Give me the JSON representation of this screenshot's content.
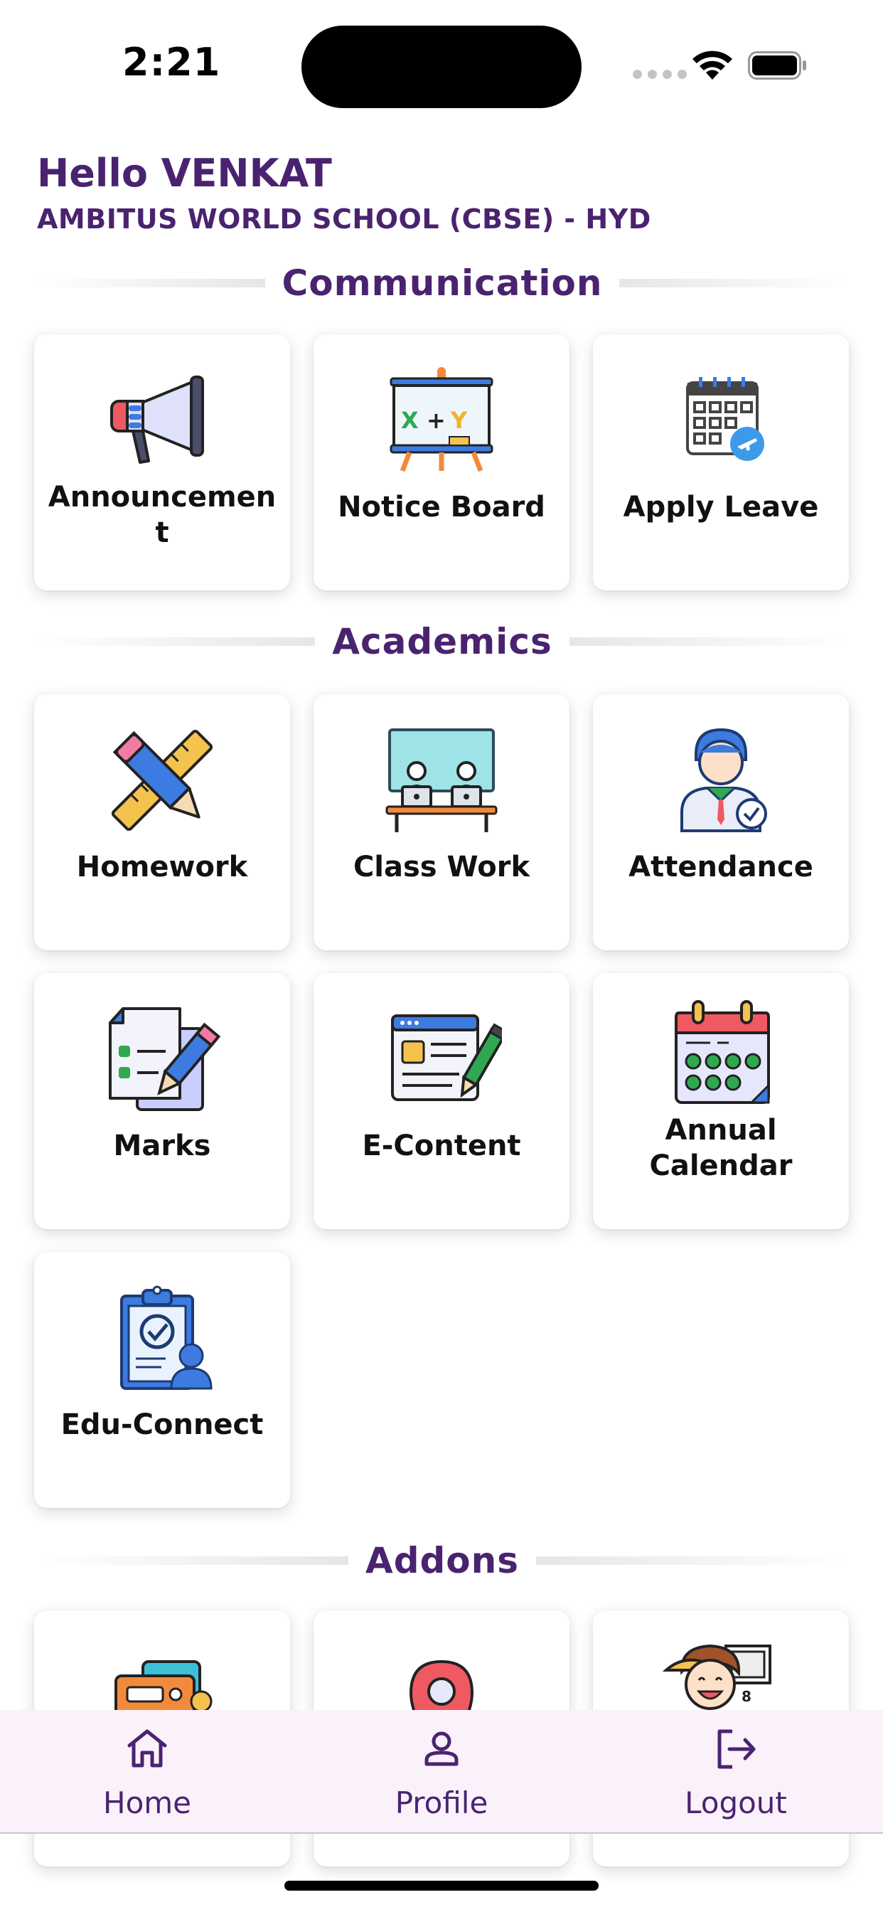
{
  "status_bar": {
    "time": "2:21"
  },
  "header": {
    "greeting": "Hello VENKAT",
    "school": "AMBITUS WORLD SCHOOL (CBSE) - HYD"
  },
  "sections": {
    "communication": {
      "title": "Communication",
      "tiles": [
        {
          "label": "Announcemen\nt",
          "icon": "megaphone-icon"
        },
        {
          "label": "Notice Board",
          "icon": "notice-board-icon"
        },
        {
          "label": "Apply Leave",
          "icon": "calendar-leave-icon"
        }
      ]
    },
    "academics": {
      "title": "Academics",
      "tiles": [
        {
          "label": "Homework",
          "icon": "pencil-ruler-icon"
        },
        {
          "label": "Class Work",
          "icon": "classroom-icon"
        },
        {
          "label": "Attendance",
          "icon": "student-check-icon"
        },
        {
          "label": "Marks",
          "icon": "marks-sheet-icon"
        },
        {
          "label": "E-Content",
          "icon": "e-content-icon"
        },
        {
          "label": "Annual Calendar",
          "icon": "annual-calendar-icon"
        },
        {
          "label": "Edu-Connect",
          "icon": "clipboard-person-icon"
        }
      ]
    },
    "addons": {
      "title": "Addons",
      "tiles": [
        {
          "icon": "addon-media-icon"
        },
        {
          "icon": "addon-location-icon"
        },
        {
          "icon": "addon-kid-icon"
        }
      ]
    }
  },
  "bottom_nav": {
    "items": [
      {
        "label": "Home",
        "icon": "home-icon"
      },
      {
        "label": "Profile",
        "icon": "profile-icon"
      },
      {
        "label": "Logout",
        "icon": "logout-icon"
      }
    ]
  },
  "colors": {
    "brand_purple": "#4a2370",
    "nav_background": "#fbf1fb"
  }
}
